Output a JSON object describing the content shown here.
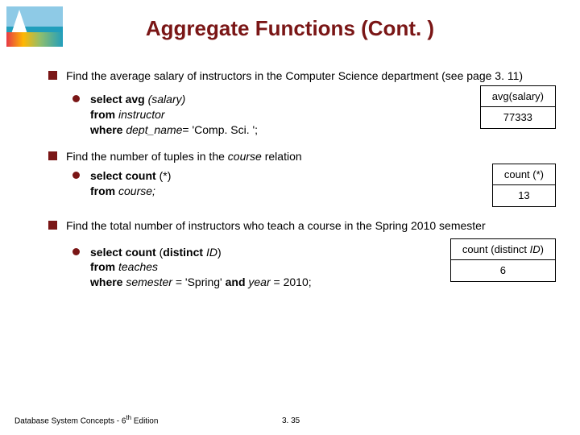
{
  "title": "Aggregate Functions (Cont. )",
  "sections": [
    {
      "bullet": "Find the average salary of instructors in the Computer Science department  (see page 3. 11)",
      "query": {
        "l1a": "select avg ",
        "l1b": "(salary)",
        "l2a": "from ",
        "l2b": "instructor",
        "l3a": "where ",
        "l3b": "dept_name",
        "l3c": "= 'Comp. Sci. ';"
      },
      "result": {
        "header": "avg(salary)",
        "value": "77333"
      }
    },
    {
      "bullet_a": "Find the number of tuples in the ",
      "bullet_b": "course",
      "bullet_c": " relation",
      "query": {
        "l1a": "select count ",
        "l1b": "(*)",
        "l2a": "from ",
        "l2b": "course;"
      },
      "result": {
        "header": "count (*)",
        "value": "13"
      }
    },
    {
      "bullet": "Find the total number of instructors who teach a course in the Spring 2010 semester",
      "query": {
        "l1a": "select count ",
        "l1b": "(",
        "l1c": "distinct ",
        "l1d": "ID",
        "l1e": ")",
        "l2a": "from ",
        "l2b": "teaches",
        "l3a": "where ",
        "l3b": "semester ",
        "l3c": "= 'Spring' ",
        "l3d": "and ",
        "l3e": "year ",
        "l3f": "= 2010;"
      },
      "result": {
        "header_a": "count (distinct ",
        "header_b": "ID",
        "header_c": ")",
        "value": "6"
      }
    }
  ],
  "footer": {
    "text_a": "Database System Concepts - 6",
    "text_b": "th",
    "text_c": " Edition"
  },
  "pagenum": "3. 35"
}
